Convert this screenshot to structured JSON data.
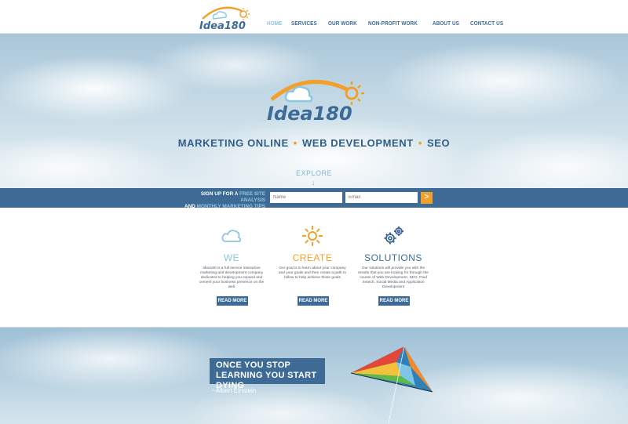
{
  "brand": {
    "logo_text": "Idea180",
    "colors": {
      "primary": "#3d6b96",
      "accent": "#f2a02a",
      "light": "#8ec6df"
    }
  },
  "nav": {
    "items": [
      {
        "label": "HOME",
        "active": true
      },
      {
        "label": "SERVICES",
        "active": false
      },
      {
        "label": "OUR WORK",
        "active": false
      },
      {
        "label": "NON-PROFIT WORK",
        "active": false
      },
      {
        "label": "ABOUT US",
        "active": false
      },
      {
        "label": "CONTACT US",
        "active": false
      }
    ]
  },
  "hero": {
    "logo_text": "Idea180",
    "tagline": [
      "MARKETING ONLINE",
      "WEB DEVELOPMENT",
      "SEO"
    ],
    "explore_label": "EXPLORE"
  },
  "signup": {
    "line1_prefix": "SIGN UP FOR A ",
    "line1_highlight": "FREE SITE ANALYSIS",
    "line2_prefix": "AND ",
    "line2_highlight": "MONTHLY MARKETING TIPS",
    "name_placeholder": "Name",
    "email_placeholder": "Email",
    "submit_label": ">"
  },
  "features": [
    {
      "title": "WE",
      "icon": "cloud-icon",
      "text": "Idea180 is a full service interactive marketing and development company dedicated to helping you expand and cement your business presence on the web",
      "button": "READ MORE"
    },
    {
      "title": "CREATE",
      "icon": "sun-icon",
      "text": "Our goal is to learn about your company and your goals and then create a path to follow to help achieve those goals",
      "button": "READ MORE"
    },
    {
      "title": "SOLUTIONS",
      "icon": "gears-icon",
      "text": "Our solutions will provide you with the results that you are looking for through the course of Web Development, SEO, Paid Search, Social Media and Application Development",
      "button": "READ MORE"
    }
  ],
  "quote": {
    "text": "ONCE YOU STOP LEARNING YOU START DYING",
    "author": "~Albert Einstein"
  }
}
